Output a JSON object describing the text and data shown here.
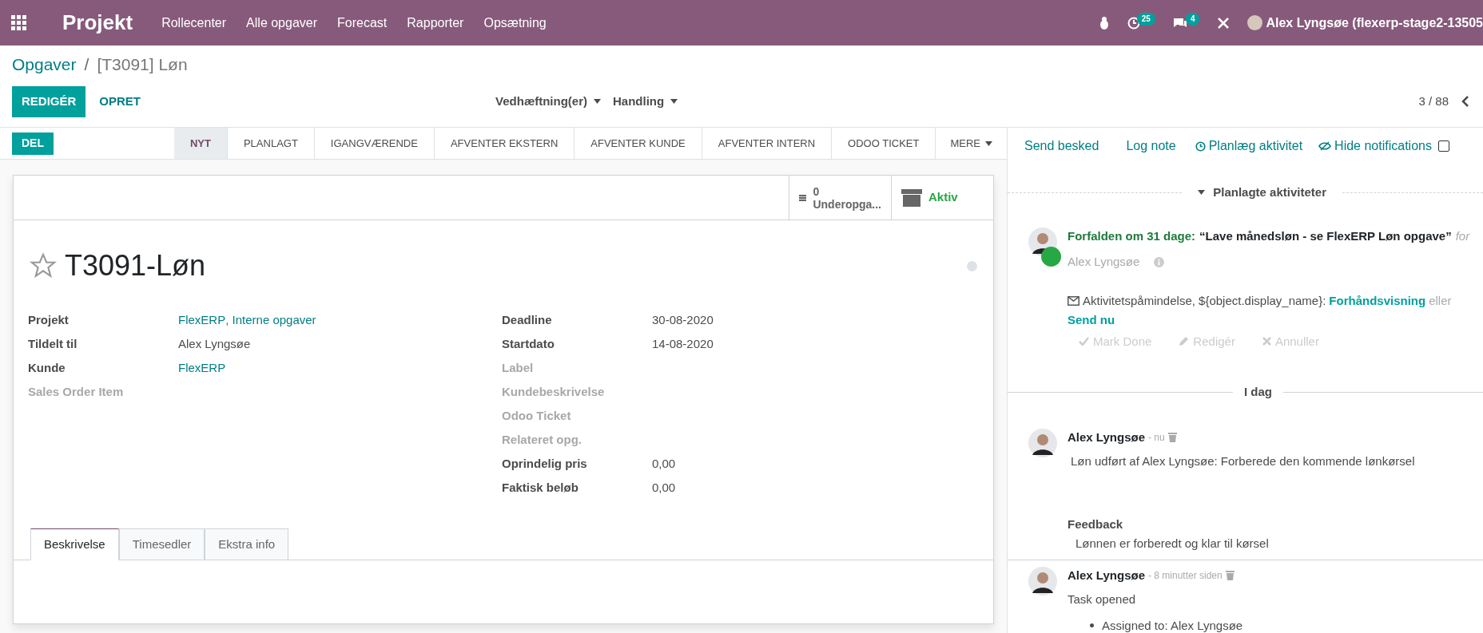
{
  "navbar": {
    "app_name": "Projekt",
    "menu": [
      "Rollecenter",
      "Alle opgaver",
      "Forecast",
      "Rapporter",
      "Opsætning"
    ],
    "activity_count": "25",
    "message_count": "4",
    "user": "Alex Lyngsøe (flexerp-stage2-13505"
  },
  "breadcrumb": {
    "parent": "Opgaver",
    "separator": "/",
    "current": "[T3091] Løn"
  },
  "control_panel": {
    "edit_button": "REDIGÉR",
    "create_button": "OPRET",
    "dropdowns": [
      "Vedhæftning(er)",
      "Handling"
    ],
    "pager": "3 / 88"
  },
  "statusbar": {
    "button": "DEL",
    "stages": [
      {
        "label": "NYT",
        "selected": true
      },
      {
        "label": "PLANLAGT",
        "selected": false
      },
      {
        "label": "IGANGVÆRENDE",
        "selected": false
      },
      {
        "label": "AFVENTER EKSTERN",
        "selected": false
      },
      {
        "label": "AFVENTER KUNDE",
        "selected": false
      },
      {
        "label": "AFVENTER INTERN",
        "selected": false
      },
      {
        "label": "ODOO TICKET",
        "selected": false
      }
    ],
    "more": "MERE"
  },
  "smart_buttons": [
    {
      "kind": "subtasks",
      "value": "0",
      "label": "Underopga..."
    },
    {
      "kind": "archive",
      "label": "Aktiv"
    }
  ],
  "title": "T3091-Løn",
  "starred": false,
  "fields_left": [
    {
      "label": "Projekt",
      "value": [
        "FlexERP",
        ", Interne opgaver"
      ],
      "kind": "link",
      "required": true
    },
    {
      "label": "Tildelt til",
      "value": [
        "Alex Lyngsøe"
      ],
      "kind": "text",
      "required": true
    },
    {
      "label": "Kunde",
      "value": [
        "FlexERP"
      ],
      "kind": "link",
      "required": true
    },
    {
      "label": "Sales Order Item",
      "required": false
    }
  ],
  "fields_right": [
    {
      "label": "Deadline",
      "value": [
        "30-08-2020"
      ],
      "kind": "text",
      "required": true
    },
    {
      "label": "Startdato",
      "value": [
        "14-08-2020"
      ],
      "kind": "text",
      "required": true
    },
    {
      "label": "Label",
      "required": false
    },
    {
      "label": "Kundebeskrivelse",
      "required": false
    },
    {
      "label": "Odoo Ticket",
      "required": false
    },
    {
      "label": "Relateret opg.",
      "required": false
    },
    {
      "label": "Oprindelig pris",
      "value": [
        "0,00"
      ],
      "kind": "text",
      "required": true
    },
    {
      "label": "Faktisk beløb",
      "value": [
        "0,00"
      ],
      "kind": "text",
      "required": true
    }
  ],
  "tabs": [
    {
      "label": "Beskrivelse",
      "selected": true
    },
    {
      "label": "Timesedler",
      "selected": false
    },
    {
      "label": "Ekstra info",
      "selected": false
    }
  ],
  "chatter": {
    "send_message": "Send besked",
    "log_note": "Log note",
    "schedule": "Planlæg aktivitet",
    "hide_notifications": "Hide notifications",
    "hide_checked": false,
    "activities_header": "Planlagte aktiviteter",
    "activity": {
      "due": "Forfalden om 31 dage",
      "colon": ":",
      "summary": "“Lave månedsløn - se FlexERP Løn opgave”",
      "for": "for",
      "user": "Alex Lyngsøe",
      "color": "#28a745",
      "mail_text": "Aktivitetspåmindelse, ${object.display_name}:",
      "preview": "Forhåndsvisning",
      "or": "eller",
      "send_now": "Send nu",
      "actions": [
        "Mark Done",
        "Redigér",
        "Annuller"
      ]
    },
    "date_separator": "I dag",
    "messages": [
      {
        "author": "Alex Lyngsøe",
        "time": "- nu",
        "body": "Løn udført af Alex Lyngsøe: Forberede den kommende lønkørsel",
        "feedback_title": "Feedback",
        "feedback": "Lønnen er forberedt og klar til kørsel"
      },
      {
        "author": "Alex Lyngsøe",
        "time": "- 8 minutter siden",
        "body": "Task opened",
        "bullets": [
          "Assigned to: Alex Lyngsøe"
        ]
      }
    ]
  }
}
